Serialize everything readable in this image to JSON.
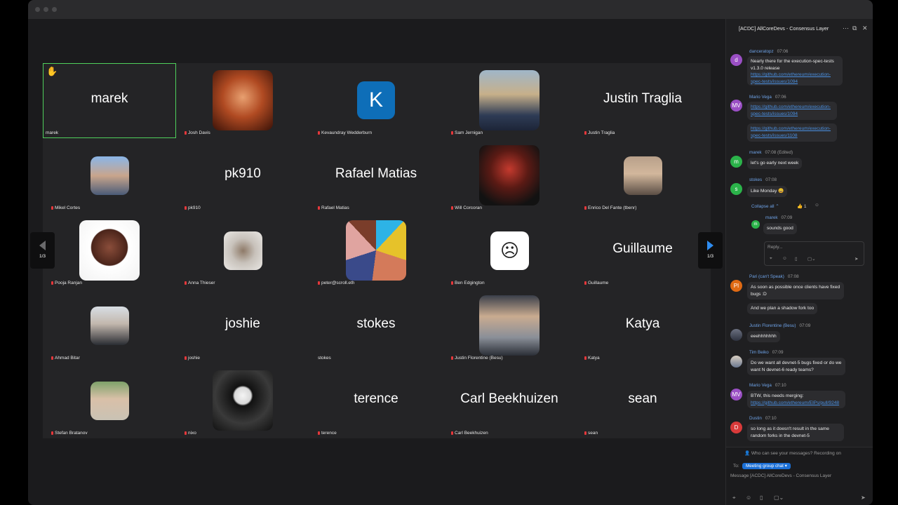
{
  "gallery": {
    "page_indicator": "1/3",
    "tiles": [
      {
        "name": "marek",
        "display": "marek",
        "raised_hand": true,
        "active": true
      },
      {
        "name": "Josh Davis"
      },
      {
        "name": "Kevaundray Wedderburn",
        "avatar_letter": "K"
      },
      {
        "name": "Sam Jernigan"
      },
      {
        "name": "Justin Traglia",
        "display": "Justin Traglia"
      },
      {
        "name": "Mikel Cortes"
      },
      {
        "name": "pk910",
        "display": "pk910"
      },
      {
        "name": "Rafael Matias",
        "display": "Rafael Matias"
      },
      {
        "name": "Will Corcoran"
      },
      {
        "name": "Enrico Del Fante (tbenr)"
      },
      {
        "name": "Pooja Ranjan"
      },
      {
        "name": "Anna Thieser"
      },
      {
        "name": "peter@scroll.eth"
      },
      {
        "name": "Ben Edgington"
      },
      {
        "name": "Guillaume",
        "display": "Guillaume"
      },
      {
        "name": "Ahmad Bitar"
      },
      {
        "name": "joshie",
        "display": "joshie"
      },
      {
        "name": "stokes",
        "display": "stokes",
        "no_mic": true
      },
      {
        "name": "Justin Florentine (Besu)"
      },
      {
        "name": "Katya",
        "display": "Katya"
      },
      {
        "name": "Stefan Bratanov"
      },
      {
        "name": "nixo"
      },
      {
        "name": "terence",
        "display": "terence"
      },
      {
        "name": "Carl Beekhuizen",
        "display": "Carl Beekhuizen"
      },
      {
        "name": "sean",
        "display": "sean"
      }
    ]
  },
  "chat": {
    "title": "[ACDC] AllCoreDevs - Consensus Layer",
    "messages": {
      "m1": {
        "author": "danceratopz",
        "time": "07:06",
        "text": "Nearly there for the execution-spec-tests v1.3.0 release",
        "link": "https://github.com/ethereum/execution-spec-tests/issues/1094",
        "avatar": "d"
      },
      "m2": {
        "author": "Mario Vega",
        "time": "07:06",
        "link1": "https://github.com/ethereum/execution-spec-tests/issues/1094",
        "link2": "https://github.com/ethereum/execution-spec-tests/issues/1108",
        "avatar": "MV"
      },
      "m3": {
        "author": "marek",
        "time": "07:08 (Edited)",
        "text": "let's go early next week",
        "avatar": "m"
      },
      "m4": {
        "author": "stokes",
        "time": "07:08",
        "text": "Like Monday 😀",
        "avatar": "s",
        "collapse": "Collapse all",
        "reaction": "👍 1"
      },
      "m4r": {
        "author": "marek",
        "time": "07:09",
        "text": "sounds good",
        "avatar": "m",
        "reply_placeholder": "Reply..."
      },
      "m5": {
        "author": "Pari (can't Speak)",
        "time": "07:08",
        "text": "As soon as possible once clients have fixed bugs :D",
        "text2": "And we plan a shadow fork too",
        "avatar": "PI"
      },
      "m6": {
        "author": "Justin Florentine (Besu)",
        "time": "07:09",
        "text": "eeehhhhhhh"
      },
      "m7": {
        "author": "Tim Beiko",
        "time": "07:09",
        "text": "Do we want all devnet-5 bugs fixed or do we want N devnet-6 ready teams?"
      },
      "m8": {
        "author": "Mario Vega",
        "time": "07:10",
        "text": "BTW, this needs merging: ",
        "link": "https://github.com/ethereum/EIPs/pull/9248",
        "avatar": "MV"
      },
      "m9": {
        "author": "Dustin",
        "time": "07:10",
        "text": "so long as it doesn't result in the same random forks in the devnet-5",
        "avatar": "D"
      }
    },
    "privacy_note": "Who can see your messages? Recording on",
    "to_label": "To:",
    "to_value": "Meeting group chat",
    "input_placeholder": "Message [ACDC] AllCoreDevs - Consensus Layer"
  }
}
